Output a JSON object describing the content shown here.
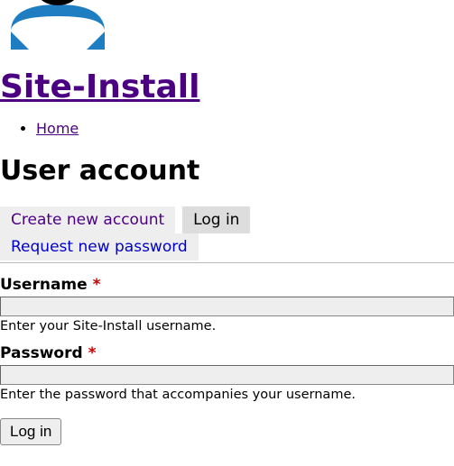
{
  "site": {
    "title": "Site-Install"
  },
  "breadcrumb": {
    "items": [
      "Home"
    ]
  },
  "page": {
    "heading": "User account"
  },
  "tabs": {
    "create": "Create new account",
    "login": "Log in",
    "request": "Request new password"
  },
  "form": {
    "username": {
      "label": "Username",
      "required": "*",
      "description": "Enter your Site-Install username."
    },
    "password": {
      "label": "Password",
      "required": "*",
      "description": "Enter the password that accompanies your username."
    },
    "submit": "Log in"
  }
}
